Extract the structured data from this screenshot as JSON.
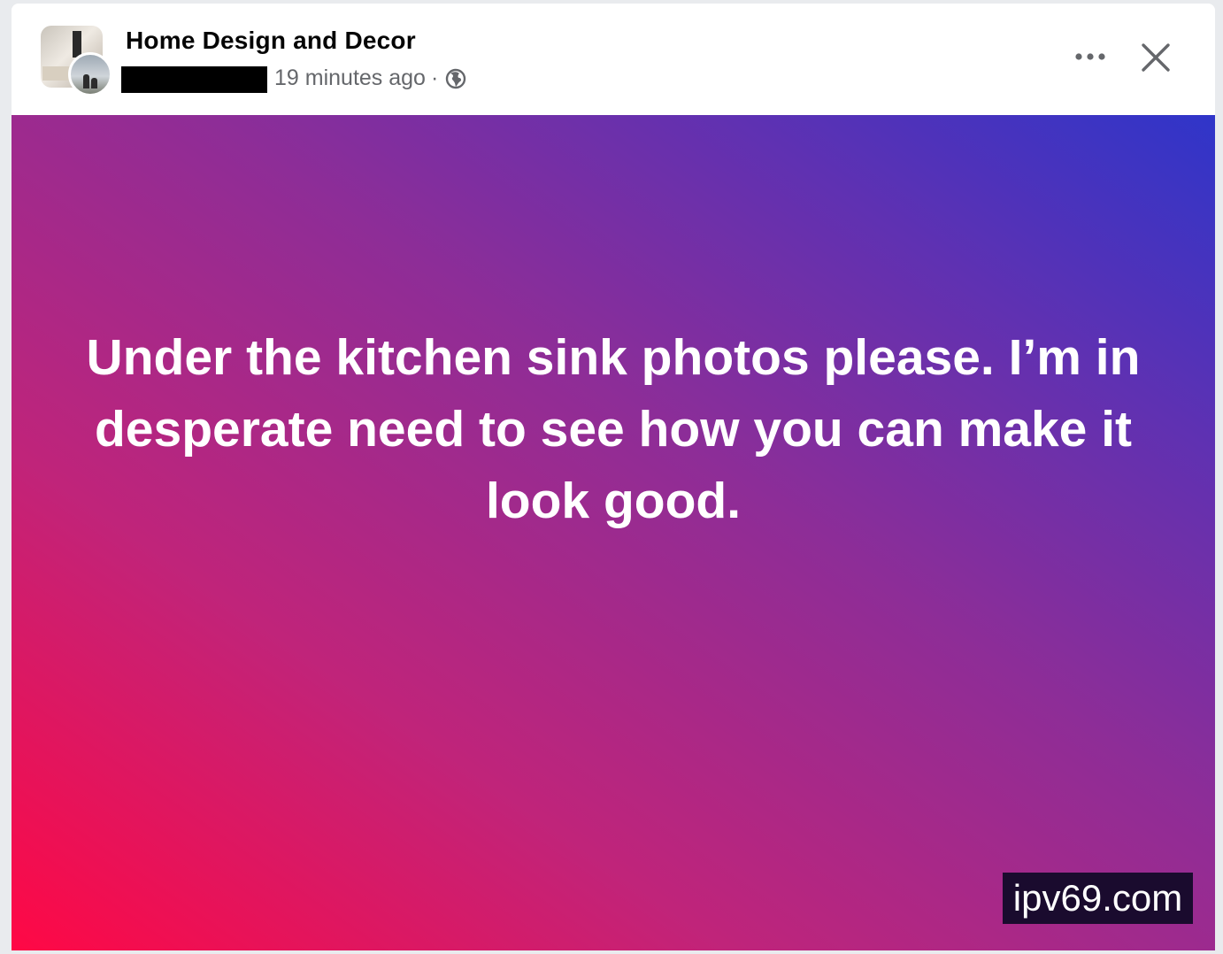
{
  "post": {
    "group_name": "Home Design and Decor",
    "timestamp": "19 minutes ago",
    "separator": "·",
    "privacy_icon": "globe-icon",
    "more_icon": "more-options-icon",
    "close_icon": "close-icon",
    "body_text": "Under the kitchen sink photos please. I’m in desperate need to see how you can make it look good.",
    "background_gradient": [
      "#ff0845",
      "#c0247a",
      "#8e2d97",
      "#5f31b2",
      "#2f35c9"
    ],
    "text_color": "#ffffff"
  },
  "watermark": {
    "text": "ipv69.com"
  }
}
